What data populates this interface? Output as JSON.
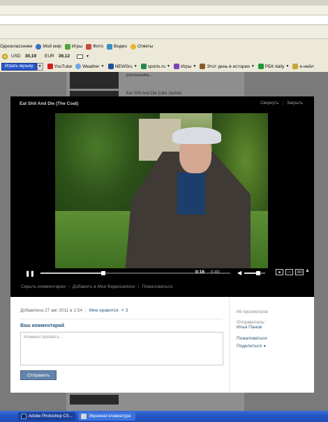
{
  "toolbar_row1": {
    "items": [
      {
        "label": "Одноклассники",
        "icon": "odnoklassniki-icon"
      },
      {
        "label": "Мой мир",
        "icon": "moy-mir-icon"
      },
      {
        "label": "Игры",
        "icon": "games-icon"
      },
      {
        "label": "Фото",
        "icon": "photo-icon"
      },
      {
        "label": "Видео",
        "icon": "video-icon"
      },
      {
        "label": "Ответы",
        "icon": "answers-icon"
      }
    ]
  },
  "toolbar_row2": {
    "usd_label": "USD",
    "usd_value": "30,19",
    "eur_label": "EUR",
    "eur_value": "39,12"
  },
  "toolbar_row3": {
    "play_music": "Играть музыку",
    "items": [
      {
        "label": "YouTube",
        "icon": "youtube-icon"
      },
      {
        "label": "Weather",
        "icon": "weather-icon"
      },
      {
        "label": "NEWSru",
        "icon": "newsru-icon"
      },
      {
        "label": "sports.ru",
        "icon": "sports-icon"
      },
      {
        "label": "Игры",
        "icon": "games-icon"
      },
      {
        "label": "Этот день в истории",
        "icon": "history-icon"
      },
      {
        "label": "РБК daily",
        "icon": "rbk-icon"
      },
      {
        "label": "е-нейл",
        "icon": "mail-icon"
      }
    ]
  },
  "background_page": {
    "snippet1": "рассказыва...",
    "snippet2": "Eat Shit And Die (Like Jackie)"
  },
  "video": {
    "title": "Eat Shit And Die (The Coat)",
    "minimize": "Свернуть",
    "close": "Закрыть",
    "time_current": "0:16",
    "time_total": "0:49",
    "progress": 0.33,
    "volume": 0.65,
    "hd_label": "360",
    "actions": [
      "Скрыть комментарии",
      "Добавить в Мои Видеозаписи",
      "Пожаловаться"
    ]
  },
  "info": {
    "added": "Добавлена 27 авг 2011 в 1:54",
    "like": "Мне нравится",
    "likes_count": "3",
    "comment_title": "Ваш комментарий",
    "comment_placeholder": "Комментировать...",
    "send": "Отправить",
    "views": "66 просмотров",
    "sender_label": "Отправитель:",
    "sender_name": "Илья Панов",
    "complain": "Пожаловаться",
    "share": "Поделиться"
  },
  "taskbar": {
    "photoshop": "Adobe Photoshop CS...",
    "keyboard": "Экранная клавиатура"
  },
  "colors": {
    "link": "#2b587a",
    "send_button": "#6383a8",
    "taskbar": "#2456c4"
  }
}
